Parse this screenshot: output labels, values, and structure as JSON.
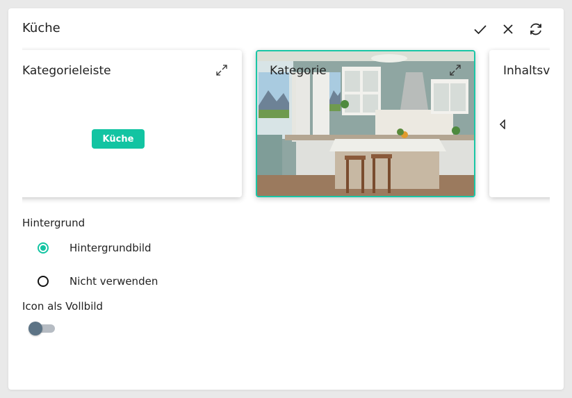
{
  "dialog": {
    "title": "Küche",
    "actions": [
      {
        "name": "confirm",
        "icon": "check-icon"
      },
      {
        "name": "close",
        "icon": "close-icon"
      },
      {
        "name": "refresh",
        "icon": "refresh-icon"
      }
    ]
  },
  "carousel": {
    "cards": [
      {
        "label": "Kategorieleiste",
        "button_label": "Küche",
        "selected": false
      },
      {
        "label": "Kategorie",
        "background": "kitchen-image",
        "selected": true
      },
      {
        "label": "Inhaltsv",
        "selected": false
      }
    ]
  },
  "background_section": {
    "label": "Hintergrund",
    "options": [
      {
        "label": "Hintergrundbild",
        "checked": true
      },
      {
        "label": "Nicht verwenden",
        "checked": false
      }
    ]
  },
  "fullscreen_icon": {
    "label": "Icon als Vollbild",
    "enabled": false
  },
  "colors": {
    "accent": "#12c4a2",
    "selected_border": "#1ac6a6",
    "toggle_knob": "#5c7385"
  }
}
